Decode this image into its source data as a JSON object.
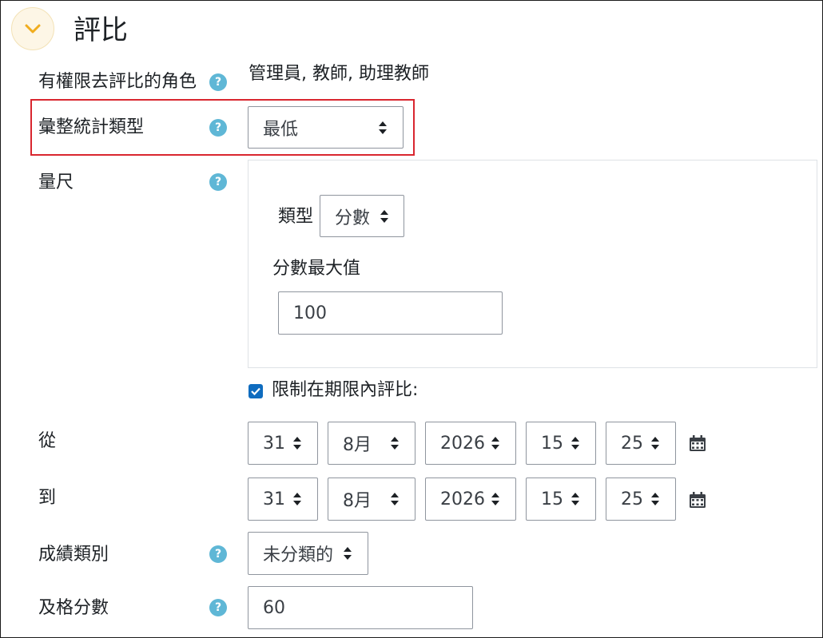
{
  "section": {
    "title": "評比",
    "toggle_icon": "chevron-down-icon"
  },
  "fields": {
    "roles": {
      "label": "有權限去評比的角色",
      "value": "管理員, 教師, 助理教師"
    },
    "aggregate": {
      "label": "彙整統計類型",
      "value": "最低"
    },
    "scale": {
      "label": "量尺",
      "type_label": "類型",
      "type_value": "分數",
      "max_label": "分數最大值",
      "max_value": "100"
    },
    "restrict": {
      "label": "限制在期限內評比:",
      "checked": true
    },
    "from": {
      "label": "從",
      "day": "31",
      "month": "8月",
      "year": "2026",
      "hour": "15",
      "minute": "25"
    },
    "to": {
      "label": "到",
      "day": "31",
      "month": "8月",
      "year": "2026",
      "hour": "15",
      "minute": "25"
    },
    "grade_category": {
      "label": "成績類別",
      "value": "未分類的"
    },
    "grade_pass": {
      "label": "及格分數",
      "value": "60"
    }
  },
  "help_symbol": "?",
  "colors": {
    "accent": "#0f6cbf",
    "help": "#5fb7d6",
    "highlight": "#d9262f",
    "toggle_bg": "#fdf6e6",
    "chevron": "#f0ad1e"
  }
}
